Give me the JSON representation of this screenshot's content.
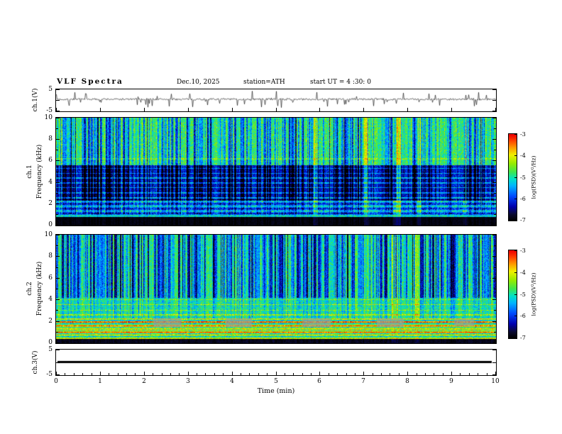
{
  "figure": {
    "background": "#ffffff"
  },
  "header": {
    "title": "VLF  Spectra",
    "date": "Dec.10, 2025",
    "station": "station=ATH",
    "start_ut": "start UT =  4 :30: 0"
  },
  "xaxis": {
    "label": "Time  (min)",
    "lim": [
      0,
      10
    ],
    "ticks": [
      0,
      1,
      2,
      3,
      4,
      5,
      6,
      7,
      8,
      9,
      10
    ]
  },
  "colorbar": {
    "label": "log(PSD)(V²/Hz)",
    "lim": [
      -7,
      -3
    ],
    "ticks": [
      -3,
      -4,
      -5,
      -6,
      -7
    ],
    "colormap_stops": [
      [
        0.0,
        [
          0,
          0,
          0
        ]
      ],
      [
        0.07,
        [
          10,
          10,
          50
        ]
      ],
      [
        0.16,
        [
          0,
          0,
          175
        ]
      ],
      [
        0.28,
        [
          0,
          75,
          255
        ]
      ],
      [
        0.4,
        [
          0,
          180,
          255
        ]
      ],
      [
        0.48,
        [
          0,
          225,
          200
        ]
      ],
      [
        0.56,
        [
          60,
          230,
          80
        ]
      ],
      [
        0.66,
        [
          150,
          235,
          0
        ]
      ],
      [
        0.76,
        [
          240,
          240,
          0
        ]
      ],
      [
        0.85,
        [
          255,
          150,
          0
        ]
      ],
      [
        0.93,
        [
          255,
          60,
          0
        ]
      ],
      [
        1.0,
        [
          235,
          0,
          0
        ]
      ]
    ]
  },
  "chart_data": [
    {
      "id": "ch1-wave",
      "type": "line",
      "ylabel": "ch.1(V)",
      "ylim": [
        -5,
        5
      ],
      "yticks": [
        5,
        -5
      ],
      "ytick_marks": [
        5,
        0,
        -5
      ],
      "xlim": [
        0,
        10
      ],
      "seed": 7,
      "render_params": {
        "mean": 0.35,
        "noise_amp": 0.45,
        "spike_prob": 0.12,
        "spike_min": 0.8,
        "spike_max": 3.6,
        "spike_down_ratio": 0.55
      }
    },
    {
      "id": "ch1-spec",
      "type": "heatmap",
      "channel_label": "ch.1",
      "ylabel": "Frequency (kHz)",
      "ylim": [
        0,
        10
      ],
      "yticks": [
        0,
        2,
        4,
        6,
        8,
        10
      ],
      "yticks_minor": [
        1,
        3,
        5,
        7,
        9
      ],
      "value_lim": [
        -7,
        -3
      ],
      "xlim": [
        0,
        10
      ],
      "seed": 13,
      "render_params": {
        "bands": [
          {
            "f0": 0.0,
            "f1": 0.75,
            "v": 0.03,
            "n": 0.02
          },
          {
            "f0": 0.75,
            "f1": 2.3,
            "v": 0.37,
            "n": 0.12
          },
          {
            "f0": 2.3,
            "f1": 5.6,
            "v": 0.22,
            "n": 0.09
          },
          {
            "f0": 5.6,
            "f1": 10.0,
            "v": 0.56,
            "n": 0.11
          }
        ],
        "stripes": [
          {
            "f0": 0.75,
            "f1": 2.4,
            "period": 0.45,
            "amp": 0.13
          }
        ],
        "tone_lines": [
          {
            "f": 2.55,
            "dv": 0.22,
            "w": 0.12
          },
          {
            "f": 3.0,
            "dv": 0.2,
            "w": 0.1
          },
          {
            "f": 3.5,
            "dv": 0.22,
            "w": 0.1
          },
          {
            "f": 3.95,
            "dv": 0.2,
            "w": 0.1
          },
          {
            "f": 4.4,
            "dv": 0.22,
            "w": 0.1
          },
          {
            "f": 4.85,
            "dv": 0.18,
            "w": 0.1
          },
          {
            "f": 5.3,
            "dv": 0.18,
            "w": 0.1
          },
          {
            "f": 6.2,
            "dv": 0.1,
            "w": 0.14
          }
        ],
        "streaks": {
          "prob": 0.42,
          "min": 0.08,
          "max": 0.4,
          "fmin": 2.3,
          "fmid": 1.0,
          "mid_factor": 0.5,
          "low_factor": 0.12
        },
        "bright_columns": [
          {
            "t": 5.9,
            "w": 0.1,
            "dv": 0.14
          },
          {
            "t": 7.05,
            "w": 0.1,
            "dv": 0.18
          },
          {
            "t": 7.75,
            "w": 0.16,
            "dv": 0.3
          },
          {
            "t": 8.25,
            "w": 0.1,
            "dv": 0.26
          },
          {
            "t": 9.3,
            "w": 0.08,
            "dv": 0.2
          }
        ]
      }
    },
    {
      "id": "ch2-spec",
      "type": "heatmap",
      "channel_label": "ch.2",
      "ylabel": "Frequency (kHz)",
      "ylim": [
        0,
        10
      ],
      "yticks": [
        0,
        2,
        4,
        6,
        8,
        10
      ],
      "yticks_minor": [
        1,
        3,
        5,
        7,
        9
      ],
      "value_lim": [
        -7,
        -3
      ],
      "xlim": [
        0,
        10
      ],
      "seed": 29,
      "render_params": {
        "bands": [
          {
            "f0": 0.0,
            "f1": 0.35,
            "v": 0.05,
            "n": 0.03
          },
          {
            "f0": 0.35,
            "f1": 2.3,
            "v": 0.6,
            "n": 0.13
          },
          {
            "f0": 2.3,
            "f1": 4.3,
            "v": 0.54,
            "n": 0.11
          },
          {
            "f0": 4.3,
            "f1": 10.0,
            "v": 0.53,
            "n": 0.1
          }
        ],
        "stripes": [
          {
            "f0": 0.35,
            "f1": 2.3,
            "period": 0.3,
            "amp": 0.16
          }
        ],
        "tone_lines": [
          {
            "f": 0.95,
            "dv": 0.24,
            "w": 0.1
          },
          {
            "f": 1.18,
            "dv": 0.33,
            "w": 0.07
          },
          {
            "f": 1.55,
            "dv": 0.24,
            "w": 0.1
          },
          {
            "f": 1.95,
            "dv": 0.2,
            "w": 0.09
          },
          {
            "f": 2.6,
            "dv": 0.18,
            "w": 0.09
          },
          {
            "f": 3.05,
            "dv": 0.15,
            "w": 0.08
          },
          {
            "f": 3.55,
            "dv": 0.17,
            "w": 0.08
          },
          {
            "f": 4.0,
            "dv": 0.13,
            "w": 0.08
          }
        ],
        "streaks": {
          "prob": 0.48,
          "min": 0.1,
          "max": 0.45,
          "fmin": 4.2,
          "fmid": 2.3,
          "mid_factor": 0.35,
          "low_factor": 0.08
        },
        "bright_columns": [
          {
            "t": 7.7,
            "w": 0.12,
            "dv": 0.13
          },
          {
            "t": 8.2,
            "w": 0.08,
            "dv": 0.11
          }
        ],
        "gray_patches": [
          {
            "t0": 2.2,
            "t1": 2.85,
            "f0": 1.5,
            "f1": 2.25
          },
          {
            "t0": 3.85,
            "t1": 4.45,
            "f0": 1.5,
            "f1": 2.25
          },
          {
            "t0": 5.6,
            "t1": 6.25,
            "f0": 1.5,
            "f1": 2.25
          },
          {
            "t0": 7.3,
            "t1": 7.9,
            "f0": 1.5,
            "f1": 2.25
          },
          {
            "t0": 9.05,
            "t1": 9.5,
            "f0": 1.55,
            "f1": 2.2
          }
        ]
      }
    },
    {
      "id": "ch3-wave",
      "type": "line",
      "ylabel": "ch.3(V)",
      "ylim": [
        -5,
        5
      ],
      "yticks": [
        5,
        -5
      ],
      "ytick_marks": [
        5,
        0,
        -5
      ],
      "xlim": [
        0,
        10
      ],
      "flat_value": 0,
      "line_thickness": 3
    }
  ]
}
